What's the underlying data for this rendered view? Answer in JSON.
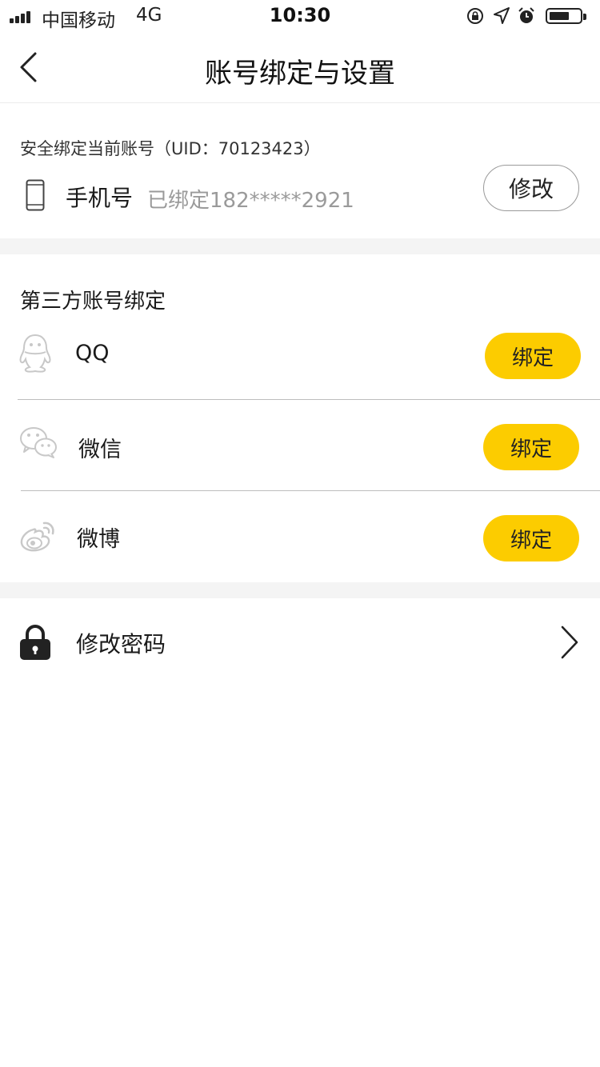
{
  "status_bar": {
    "carrier": "中国移动",
    "network": "4G",
    "time": "10:30"
  },
  "nav": {
    "title": "账号绑定与设置"
  },
  "security": {
    "label": "安全绑定当前账号（UID：70123423）",
    "phone_label": "手机号",
    "phone_value": "已绑定182*****2921",
    "modify_label": "修改"
  },
  "third_party": {
    "label": "第三方账号绑定",
    "items": [
      {
        "name": "QQ",
        "button": "绑定",
        "icon": "qq-icon"
      },
      {
        "name": "微信",
        "button": "绑定",
        "icon": "wechat-icon"
      },
      {
        "name": "微博",
        "button": "绑定",
        "icon": "weibo-icon"
      }
    ]
  },
  "password": {
    "label": "修改密码"
  },
  "colors": {
    "accent": "#fccc00",
    "gap_bg": "#f4f4f4",
    "muted_text": "#9a9a9a"
  }
}
